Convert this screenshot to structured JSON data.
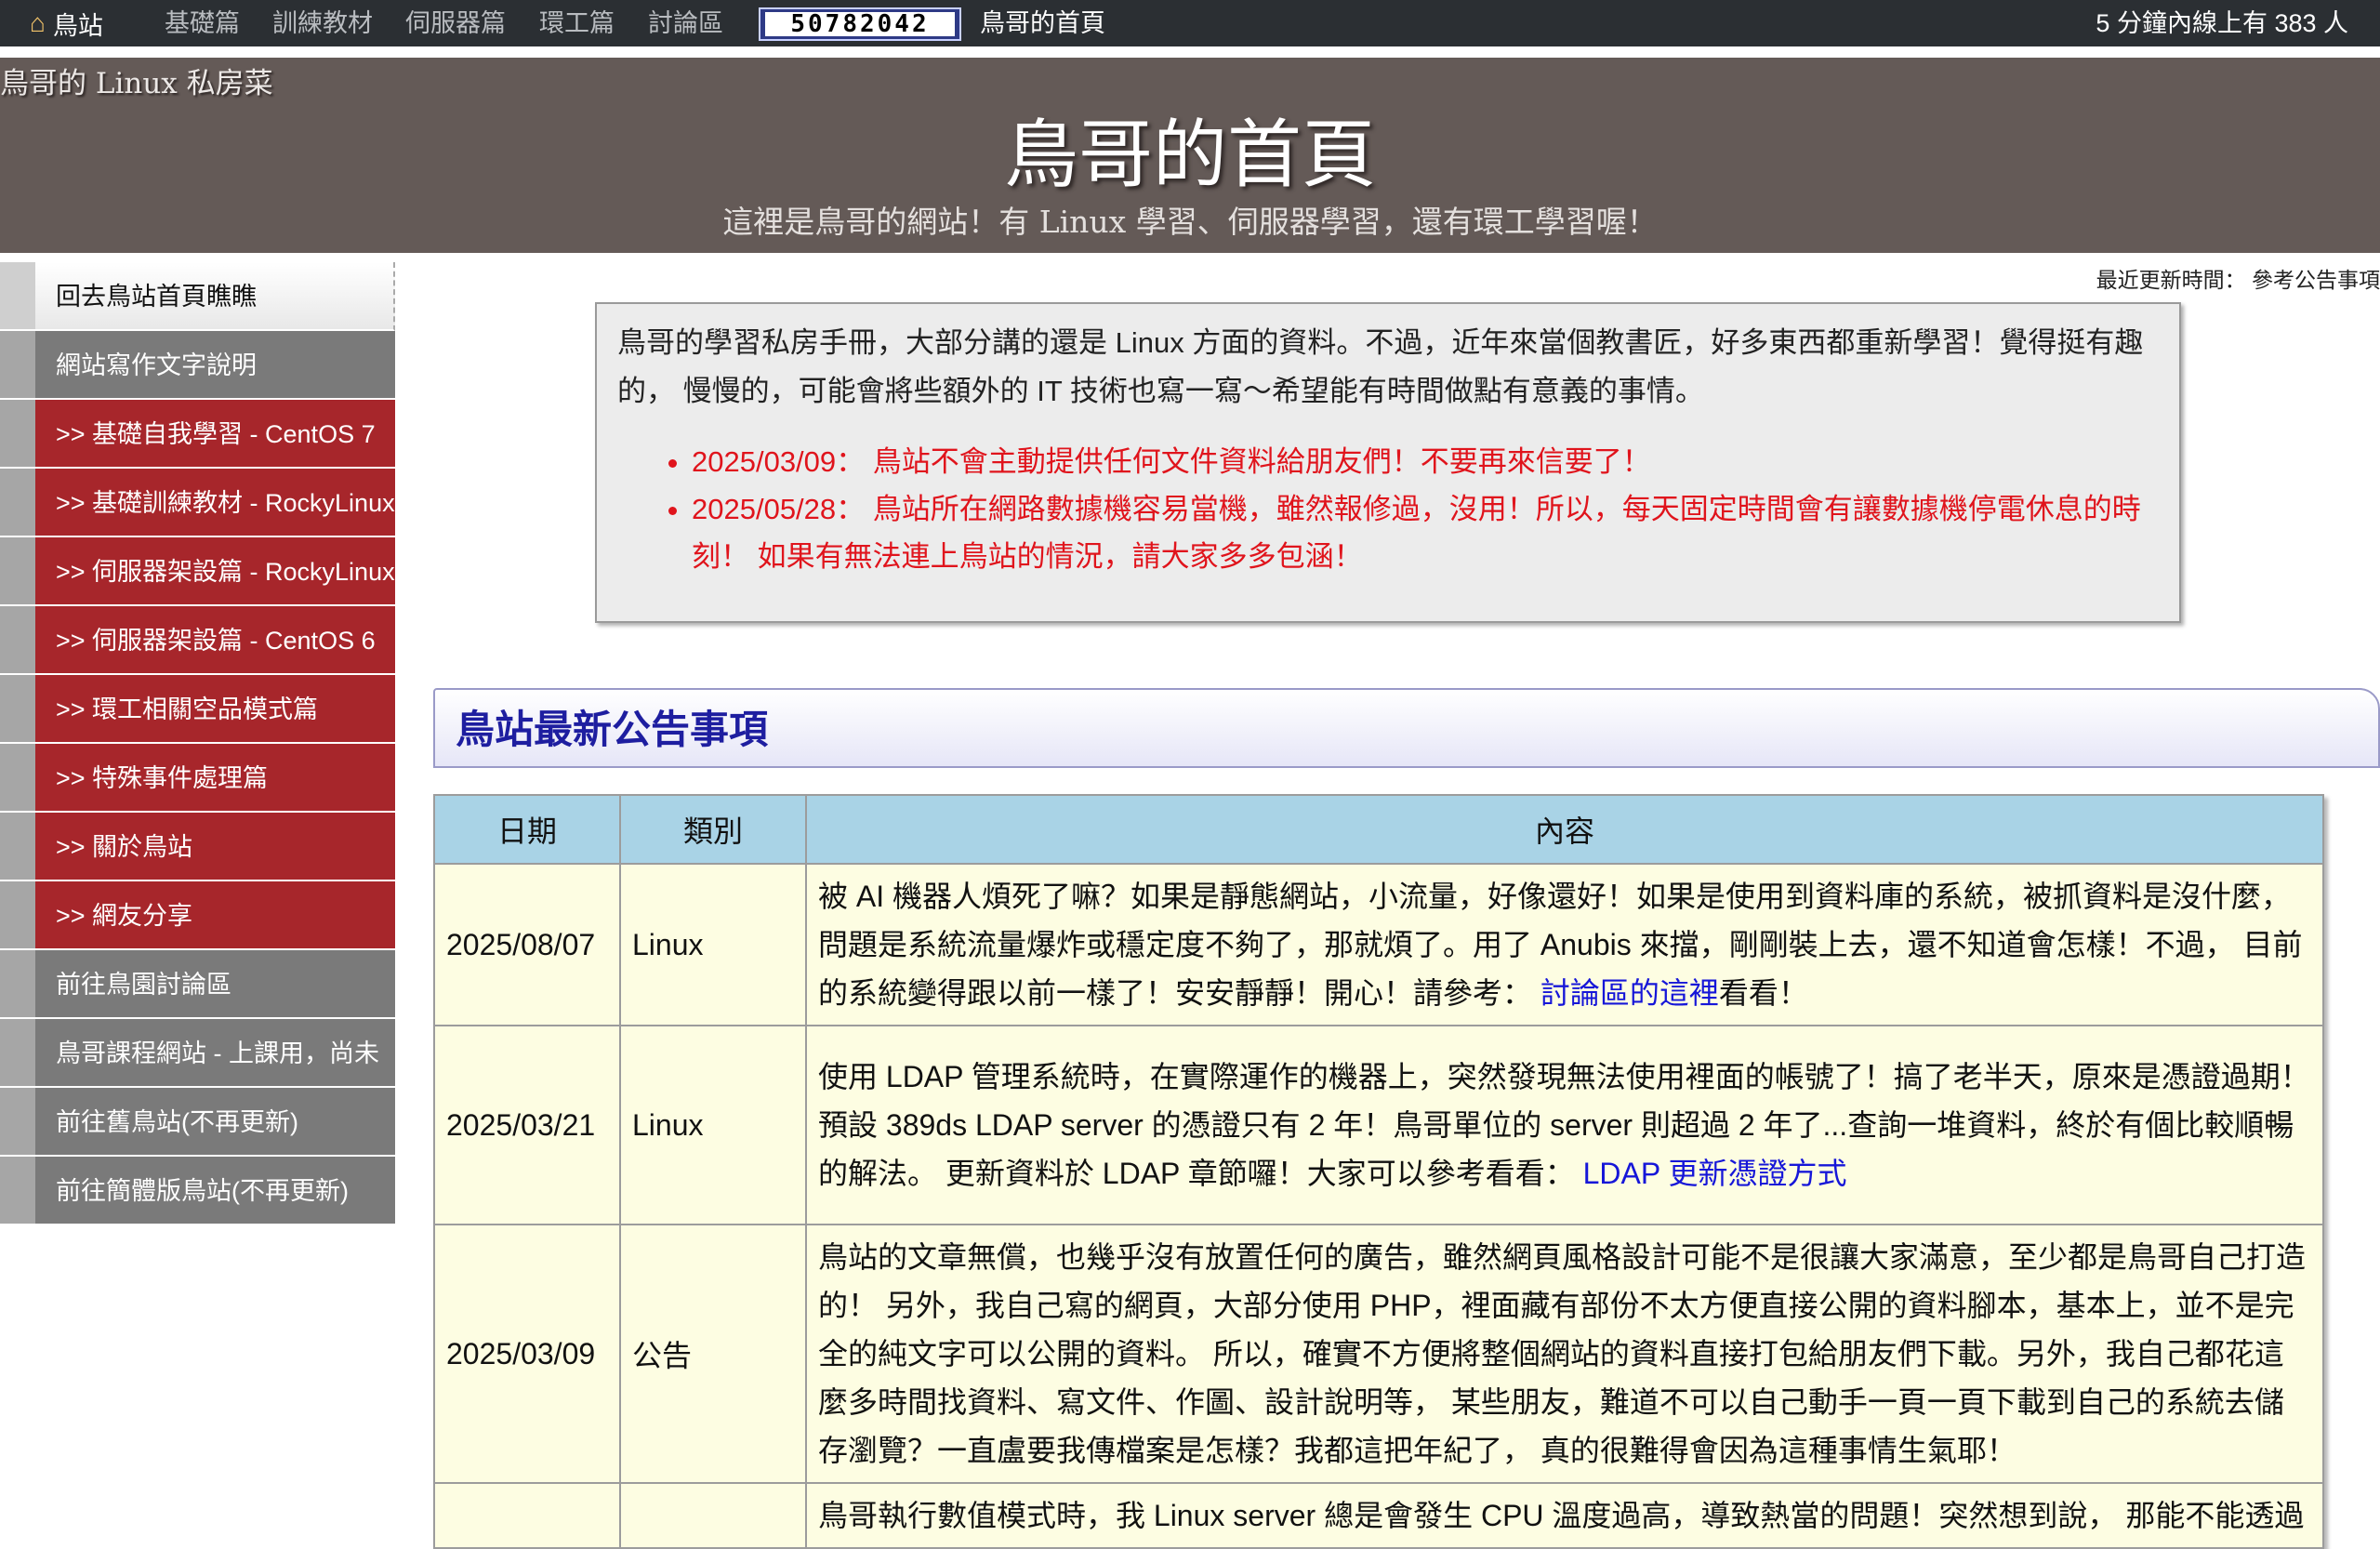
{
  "topbar": {
    "home_label": "鳥站",
    "links": [
      "基礎篇",
      "訓練教材",
      "伺服器篇",
      "環工篇",
      "討論區"
    ],
    "counter": "50782042",
    "page_name": "鳥哥的首頁",
    "online_text": "5 分鐘內線上有 383 人"
  },
  "banner": {
    "brand": "鳥哥的 Linux 私房菜",
    "title": "鳥哥的首頁",
    "subtitle": "這裡是鳥哥的網站！有 Linux 學習、伺服器學習，還有環工學習喔！"
  },
  "sidebar": {
    "items": [
      {
        "label": "回去鳥站首頁瞧瞧",
        "style": "first"
      },
      {
        "label": "網站寫作文字說明",
        "style": "gray"
      },
      {
        "label": ">> 基礎自我學習 - CentOS 7",
        "style": "red"
      },
      {
        "label": ">> 基礎訓練教材 - RockyLinux",
        "style": "red"
      },
      {
        "label": ">> 伺服器架設篇 - RockyLinux",
        "style": "red"
      },
      {
        "label": ">> 伺服器架設篇 - CentOS 6",
        "style": "red"
      },
      {
        "label": ">> 環工相關空品模式篇",
        "style": "red"
      },
      {
        "label": ">> 特殊事件處理篇",
        "style": "red"
      },
      {
        "label": ">> 關於鳥站",
        "style": "red"
      },
      {
        "label": ">> 網友分享",
        "style": "red"
      },
      {
        "label": "前往鳥園討論區",
        "style": "gray"
      },
      {
        "label": "鳥哥課程網站 - 上課用，尚未",
        "style": "gray"
      },
      {
        "label": "前往舊鳥站(不再更新)",
        "style": "gray"
      },
      {
        "label": "前往簡體版鳥站(不再更新)",
        "style": "gray"
      }
    ]
  },
  "updated_text": "最近更新時間： 參考公告事項",
  "intro": {
    "paragraph": "鳥哥的學習私房手冊，大部分講的還是 Linux 方面的資料。不過，近年來當個教書匠，好多東西都重新學習！覺得挺有趣的， 慢慢的，可能會將些額外的 IT 技術也寫一寫～希望能有時間做點有意義的事情。",
    "notices": [
      "2025/03/09： 鳥站不會主動提供任何文件資料給朋友們！不要再來信要了！",
      "2025/05/28： 鳥站所在網路數據機容易當機，雖然報修過，沒用！所以，每天固定時間會有讓數據機停電休息的時刻！ 如果有無法連上鳥站的情況，請大家多多包涵！"
    ]
  },
  "news": {
    "heading": "鳥站最新公告事項",
    "headers": [
      "日期",
      "類別",
      "內容"
    ],
    "rows": [
      {
        "date": "2025/08/07",
        "category": "Linux",
        "text": "被 AI 機器人煩死了嘛？如果是靜態網站，小流量，好像還好！如果是使用到資料庫的系統，被抓資料是沒什麼，問題是系統流量爆炸或穩定度不夠了，那就煩了。用了 Anubis 來擋，剛剛裝上去，還不知道會怎樣！不過， 目前的系統變得跟以前一樣了！安安靜靜！開心！請參考： ",
        "link": "討論區的這裡",
        "after": "看看！"
      },
      {
        "date": "2025/03/21",
        "category": "Linux",
        "text": "使用 LDAP 管理系統時，在實際運作的機器上，突然發現無法使用裡面的帳號了！搞了老半天，原來是憑證過期！預設 389ds LDAP server 的憑證只有 2 年！鳥哥單位的 server 則超過 2 年了...查詢一堆資料，終於有個比較順暢的解法。 更新資料於 LDAP 章節囉！大家可以參考看看： ",
        "link": "LDAP 更新憑證方式",
        "after": ""
      },
      {
        "date": "2025/03/09",
        "category": "公告",
        "text": "鳥站的文章無償，也幾乎沒有放置任何的廣告，雖然網頁風格設計可能不是很讓大家滿意，至少都是鳥哥自己打造的！ 另外，我自己寫的網頁，大部分使用 PHP，裡面藏有部份不太方便直接公開的資料腳本，基本上，並不是完全的純文字可以公開的資料。 所以，確實不方便將整個網站的資料直接打包給朋友們下載。另外，我自己都花這麼多時間找資料、寫文件、作圖、設計說明等， 某些朋友，難道不可以自己動手一頁一頁下載到自己的系統去儲存瀏覽？一直盧要我傳檔案是怎樣？我都這把年紀了， 真的很難得會因為這種事情生氣耶！",
        "link": "",
        "after": ""
      },
      {
        "date": "",
        "category": "",
        "text": "鳥哥執行數值模式時，我 Linux server 總是會發生 CPU 溫度過高，導致熱當的問題！突然想到說， 那能不能透過",
        "link": "",
        "after": ""
      }
    ]
  },
  "colors": {
    "topbar_bg": "#2b2f33",
    "banner_bg": "#645a57",
    "sidebar_red": "#a7262b",
    "sidebar_gray": "#7a7a7a",
    "notice_red": "#e0141c",
    "heading_blue": "#1e1ea0",
    "table_header": "#a9d3e6",
    "table_cell": "#fdfde2"
  }
}
